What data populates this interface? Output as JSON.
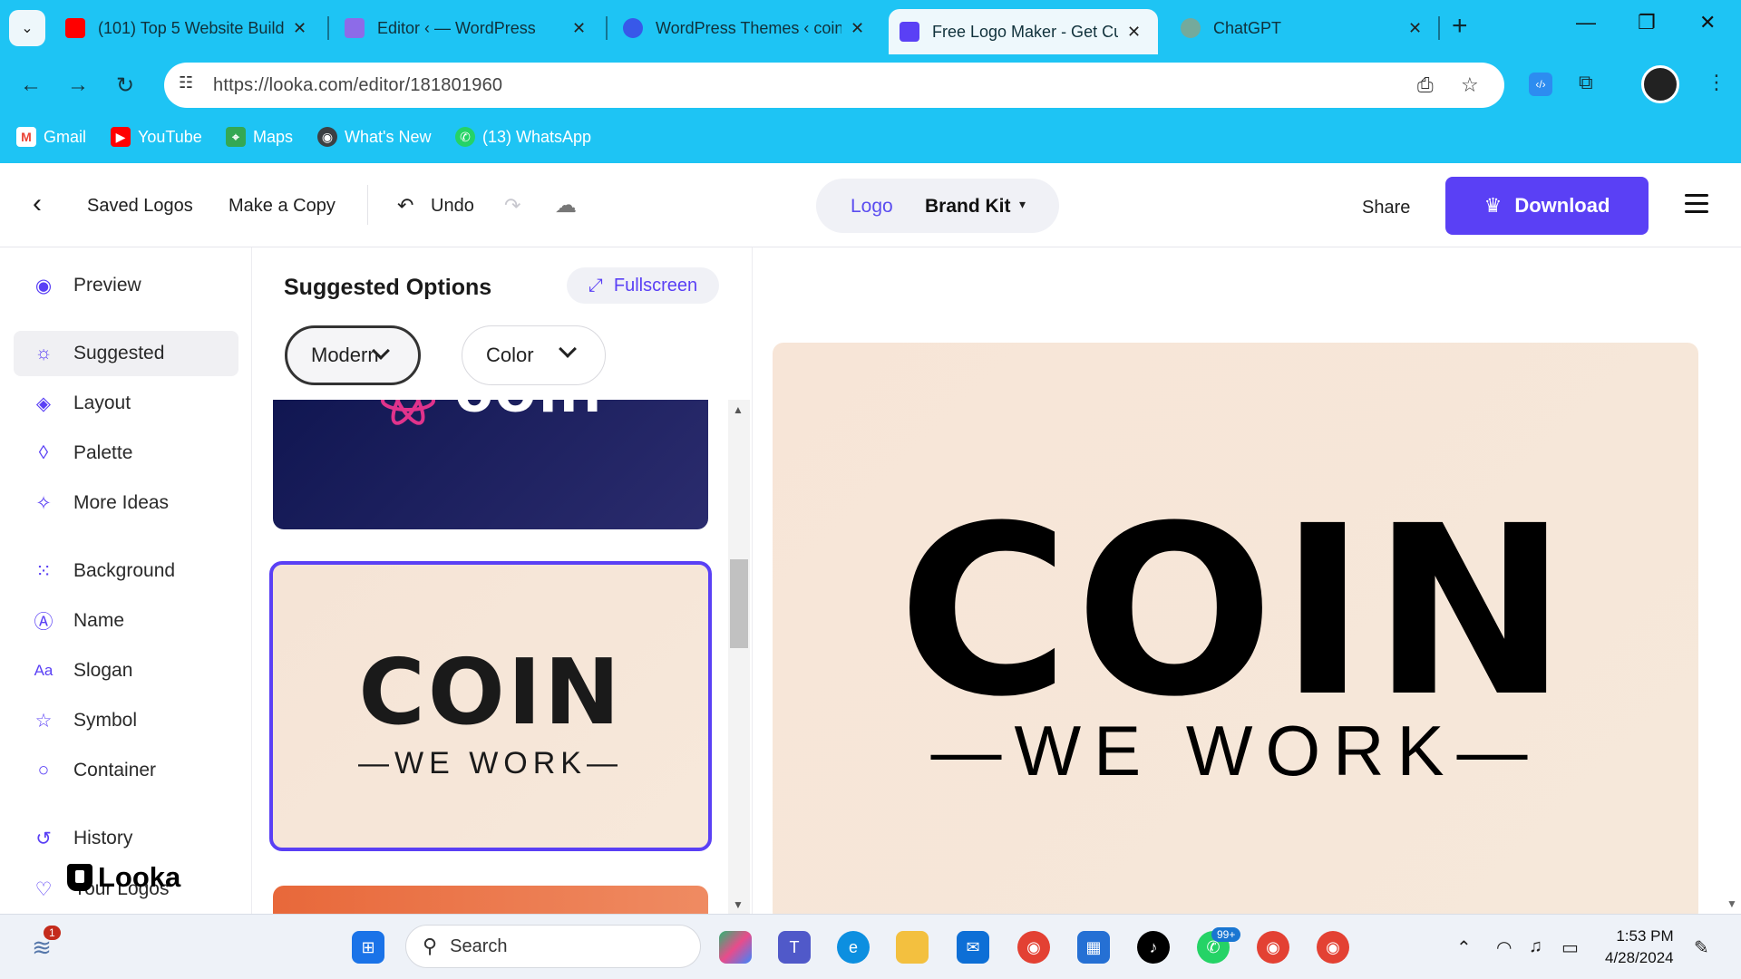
{
  "browser": {
    "tabs": [
      {
        "title": "(101) Top 5 Website Build",
        "favicon_color": "#ff0000"
      },
      {
        "title": "Editor ‹ — WordPress",
        "favicon_color": "#8d6be8"
      },
      {
        "title": "WordPress Themes ‹ coin",
        "favicon_color": "#3858e9"
      },
      {
        "title": "Free Logo Maker - Get Cu",
        "favicon_color": "#5a40f5"
      },
      {
        "title": "ChatGPT",
        "favicon_color": "#74aa9c"
      }
    ],
    "url": "https://looka.com/editor/181801960",
    "bookmarks": [
      "Gmail",
      "YouTube",
      "Maps",
      "What's New",
      "(13) WhatsApp"
    ]
  },
  "header": {
    "saved_logos": "Saved Logos",
    "make_copy": "Make a Copy",
    "undo": "Undo",
    "tab_logo": "Logo",
    "tab_brand_kit": "Brand Kit",
    "share": "Share",
    "download": "Download"
  },
  "sidebar": {
    "items": [
      "Preview",
      "Suggested",
      "Layout",
      "Palette",
      "More Ideas",
      "Background",
      "Name",
      "Slogan",
      "Symbol",
      "Container",
      "History",
      "Your Logos"
    ],
    "brand": "Looka"
  },
  "panel": {
    "title": "Suggested Options",
    "fullscreen": "Fullscreen",
    "style_filter": "Modern",
    "color_filter": "Color",
    "card1_text": "coin",
    "card2_name": "COIN",
    "card2_slogan": "—WE WORK—"
  },
  "canvas": {
    "name": "COIN",
    "slogan": "—WE WORK—"
  },
  "taskbar": {
    "search": "Search",
    "time": "1:53 PM",
    "date": "4/28/2024",
    "notification_badge": "1",
    "whatsapp_badge": "99+"
  },
  "colors": {
    "chrome": "#1ec4f4",
    "accent": "#5a40f5",
    "logo_bg": "#f7e6d8"
  }
}
